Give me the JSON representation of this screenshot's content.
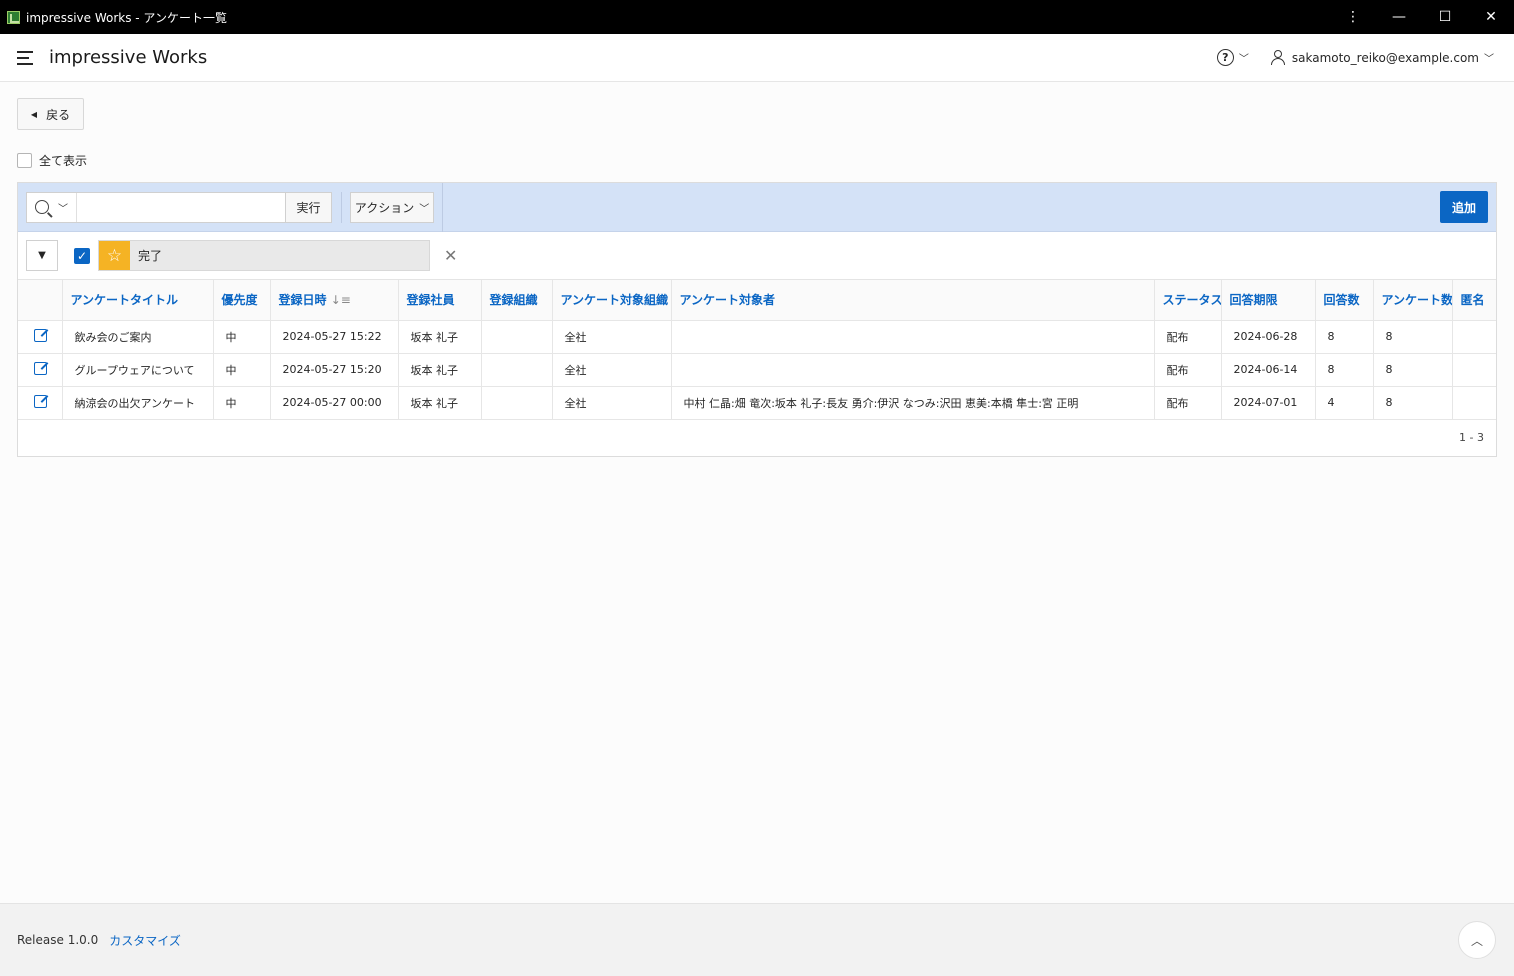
{
  "window": {
    "title": "impressive Works - アンケート一覧",
    "controls": {
      "menu": "⋮",
      "minimize": "—",
      "maximize": "☐",
      "close": "✕"
    }
  },
  "header": {
    "app_name": "impressive Works",
    "help_icon": "?",
    "user_email": "sakamoto_reiko@example.com"
  },
  "back_button": {
    "label": "戻る"
  },
  "show_all": {
    "label": "全て表示",
    "checked": false
  },
  "toolbar": {
    "search_placeholder": "",
    "go_label": "実行",
    "actions_label": "アクション",
    "add_label": "追加"
  },
  "filter": {
    "label": "完了",
    "checked": true
  },
  "table": {
    "columns": [
      "",
      "アンケートタイトル",
      "優先度",
      "登録日時",
      "登録社員",
      "登録組織",
      "アンケート対象組織",
      "アンケート対象者",
      "ステータス",
      "回答期限",
      "回答数",
      "アンケート数",
      "匿名"
    ],
    "sort_indicator": "↓≡",
    "rows": [
      {
        "title": "飲み会のご案内",
        "priority": "中",
        "registered_at": "2024-05-27 15:22",
        "employee": "坂本 礼子",
        "org": "",
        "target_org": "全社",
        "targets": "",
        "status": "配布",
        "deadline": "2024-06-28",
        "answers": "8",
        "surveys": "8",
        "anonymous": ""
      },
      {
        "title": "グループウェアについて",
        "priority": "中",
        "registered_at": "2024-05-27 15:20",
        "employee": "坂本 礼子",
        "org": "",
        "target_org": "全社",
        "targets": "",
        "status": "配布",
        "deadline": "2024-06-14",
        "answers": "8",
        "surveys": "8",
        "anonymous": ""
      },
      {
        "title": "納涼会の出欠アンケート",
        "priority": "中",
        "registered_at": "2024-05-27 00:00",
        "employee": "坂本 礼子",
        "org": "",
        "target_org": "全社",
        "targets": "中村 仁晶:畑 竜次:坂本 礼子:長友 勇介:伊沢 なつみ:沢田 恵美:本橋 隼士:宮 正明",
        "status": "配布",
        "deadline": "2024-07-01",
        "answers": "4",
        "surveys": "8",
        "anonymous": ""
      }
    ],
    "pagination": "1 - 3"
  },
  "footer": {
    "release": "Release 1.0.0",
    "customize": "カスタマイズ"
  },
  "colors": {
    "accent": "#0b66c4",
    "toolbar_bg": "#d4e2f7",
    "star": "#f5b324"
  }
}
